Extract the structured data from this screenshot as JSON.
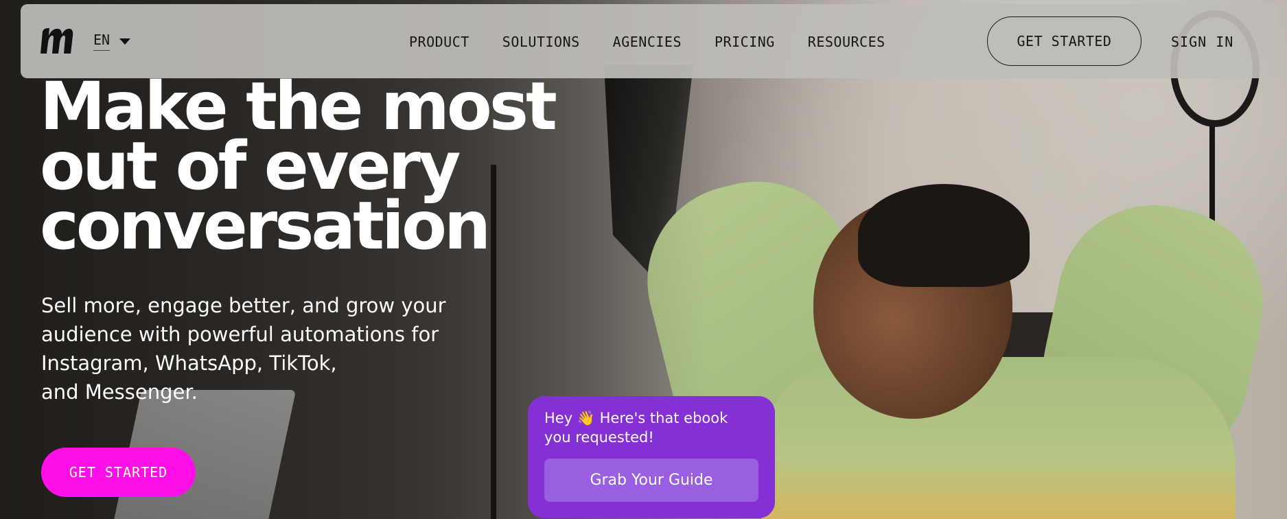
{
  "header": {
    "language": "EN",
    "nav_links": [
      {
        "label": "PRODUCT"
      },
      {
        "label": "SOLUTIONS"
      },
      {
        "label": "AGENCIES"
      },
      {
        "label": "PRICING"
      },
      {
        "label": "RESOURCES"
      }
    ],
    "cta_label": "GET STARTED",
    "signin_label": "SIGN IN"
  },
  "hero": {
    "title_lines": [
      "Make the most",
      "out of every",
      "conversation"
    ],
    "subtitle_lines": [
      "Sell more, engage better, and grow your",
      "audience with powerful automations for",
      "Instagram, WhatsApp, TikTok,",
      "and Messenger."
    ],
    "cta_label": "GET STARTED"
  },
  "chat_popup": {
    "message_start": "Hey ",
    "emoji": "👋",
    "message_end": " Here's that ebook you requested!",
    "button_label": "Grab Your Guide"
  },
  "icons": {
    "logo": "brand-logo-icon",
    "language_caret": "caret-down-icon"
  },
  "colors": {
    "nav_bg": "#bebcb8",
    "hero_cta": "#ff0fe8",
    "chat_bg": "#8530d4",
    "chat_button": "#9a5fe0",
    "text_light": "#ffffff",
    "text_dark": "#161616"
  }
}
